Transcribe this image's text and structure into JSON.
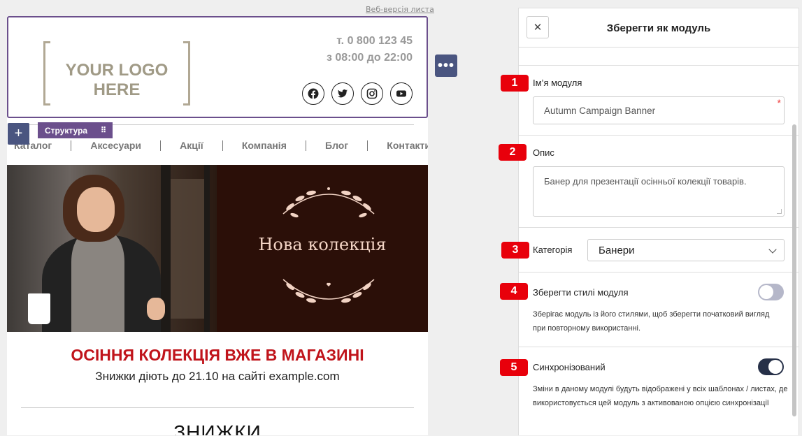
{
  "canvas": {
    "web_version_link": "Веб-версія листа",
    "logo_text": "YOUR LOGO HERE",
    "phone": "т. 0 800 123 45",
    "hours": "з 08:00 до 22:00",
    "socials": [
      "facebook-icon",
      "twitter-icon",
      "instagram-icon",
      "youtube-icon"
    ],
    "more_button": "•••",
    "add_button": "+",
    "structure_label": "Структура",
    "nav": [
      "Каталог",
      "Аксесуари",
      "Акції",
      "Компанія",
      "Блог",
      "Контакти"
    ],
    "banner_title": "Нова колекція",
    "headline": "ОСІННЯ КОЛЕКЦІЯ ВЖЕ В МАГАЗИНІ",
    "subline": "Знижки діють до 21.10 на сайті example.com",
    "discounts_heading": "ЗНИЖКИ"
  },
  "panel": {
    "title": "Зберегти як модуль",
    "close_icon": "close-icon",
    "fields": {
      "name": {
        "step": "1",
        "label": "Ім’я модуля",
        "value": "Autumn Campaign Banner",
        "required": "*"
      },
      "description": {
        "step": "2",
        "label": "Опис",
        "value": "Банер для презентації осінньої колекції товарів."
      },
      "category": {
        "step": "3",
        "label": "Категорія",
        "value": "Банери"
      },
      "save_styles": {
        "step": "4",
        "label": "Зберегти стилі модуля",
        "enabled": false,
        "help": "Зберігає модуль із його стилями, щоб зберегти початковий вигляд при повторному використанні."
      },
      "synced": {
        "step": "5",
        "label": "Синхронізований",
        "enabled": true,
        "help": "Зміни в даному модулі будуть відображені у всіх шаблонах / листах, де використовується цей модуль з активованою опцією синхронізації"
      }
    }
  },
  "colors": {
    "accent": "#4a5580",
    "structure": "#6b4f8c",
    "headline": "#c0141b",
    "badge": "#e8000b",
    "toggle_off": "#b5b7c9",
    "toggle_on": "#263048"
  }
}
